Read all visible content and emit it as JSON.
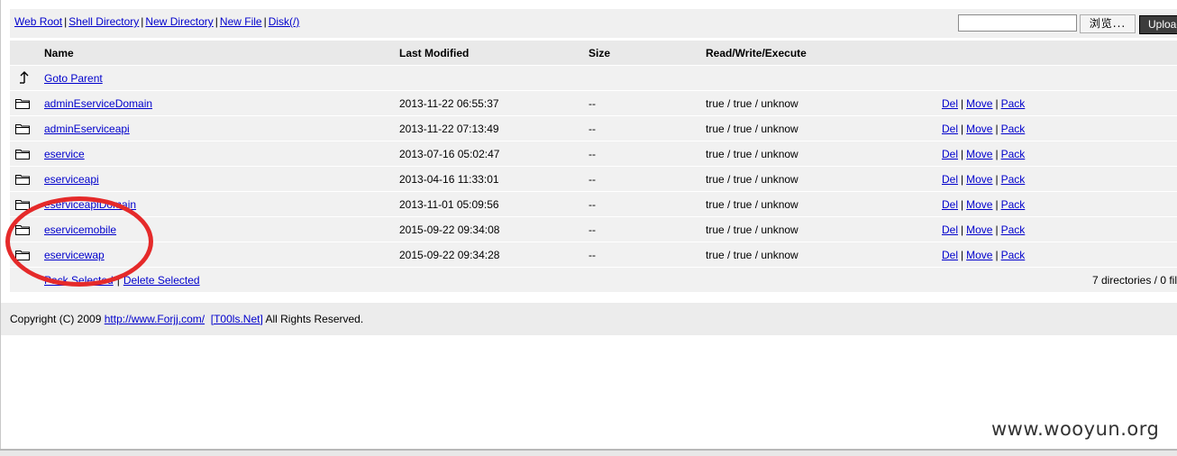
{
  "toolbar": {
    "links": [
      "Web Root",
      "Shell Directory",
      "New Directory",
      "New File",
      "Disk(/)"
    ],
    "separator": "|",
    "file_input_value": "",
    "browse_label": "浏览...",
    "upload_label": "Upload"
  },
  "table": {
    "headers": {
      "name": "Name",
      "modified": "Last Modified",
      "size": "Size",
      "rwx": "Read/Write/Execute"
    },
    "parent_link": "Goto Parent",
    "rows": [
      {
        "name": "adminEserviceDomain",
        "modified": "2013-11-22 06:55:37",
        "size": "--",
        "rwx": "true / true / unknow"
      },
      {
        "name": "adminEserviceapi",
        "modified": "2013-11-22 07:13:49",
        "size": "--",
        "rwx": "true / true / unknow"
      },
      {
        "name": "eservice",
        "modified": "2013-07-16 05:02:47",
        "size": "--",
        "rwx": "true / true / unknow"
      },
      {
        "name": "eserviceapi",
        "modified": "2013-04-16 11:33:01",
        "size": "--",
        "rwx": "true / true / unknow"
      },
      {
        "name": "eserviceapiDomain",
        "modified": "2013-11-01 05:09:56",
        "size": "--",
        "rwx": "true / true / unknow"
      },
      {
        "name": "eservicemobile",
        "modified": "2015-09-22 09:34:08",
        "size": "--",
        "rwx": "true / true / unknow"
      },
      {
        "name": "eservicewap",
        "modified": "2015-09-22 09:34:28",
        "size": "--",
        "rwx": "true / true / unknow"
      }
    ],
    "actions": {
      "del": "Del",
      "move": "Move",
      "pack": "Pack",
      "separator": "|"
    },
    "footer_links": {
      "pack_selected": "Pack Selected",
      "delete_selected": "Delete Selected",
      "separator": "|"
    },
    "summary": "7 directories / 0 fil"
  },
  "footer": {
    "prefix": "Copyright (C) 2009",
    "link1": "http://www.Forjj.com/",
    "link2": "[T00ls.Net]",
    "suffix": "All Rights Reserved."
  },
  "annotation": {
    "color": "#e52a2a"
  },
  "watermark": "www.wooyun.org"
}
